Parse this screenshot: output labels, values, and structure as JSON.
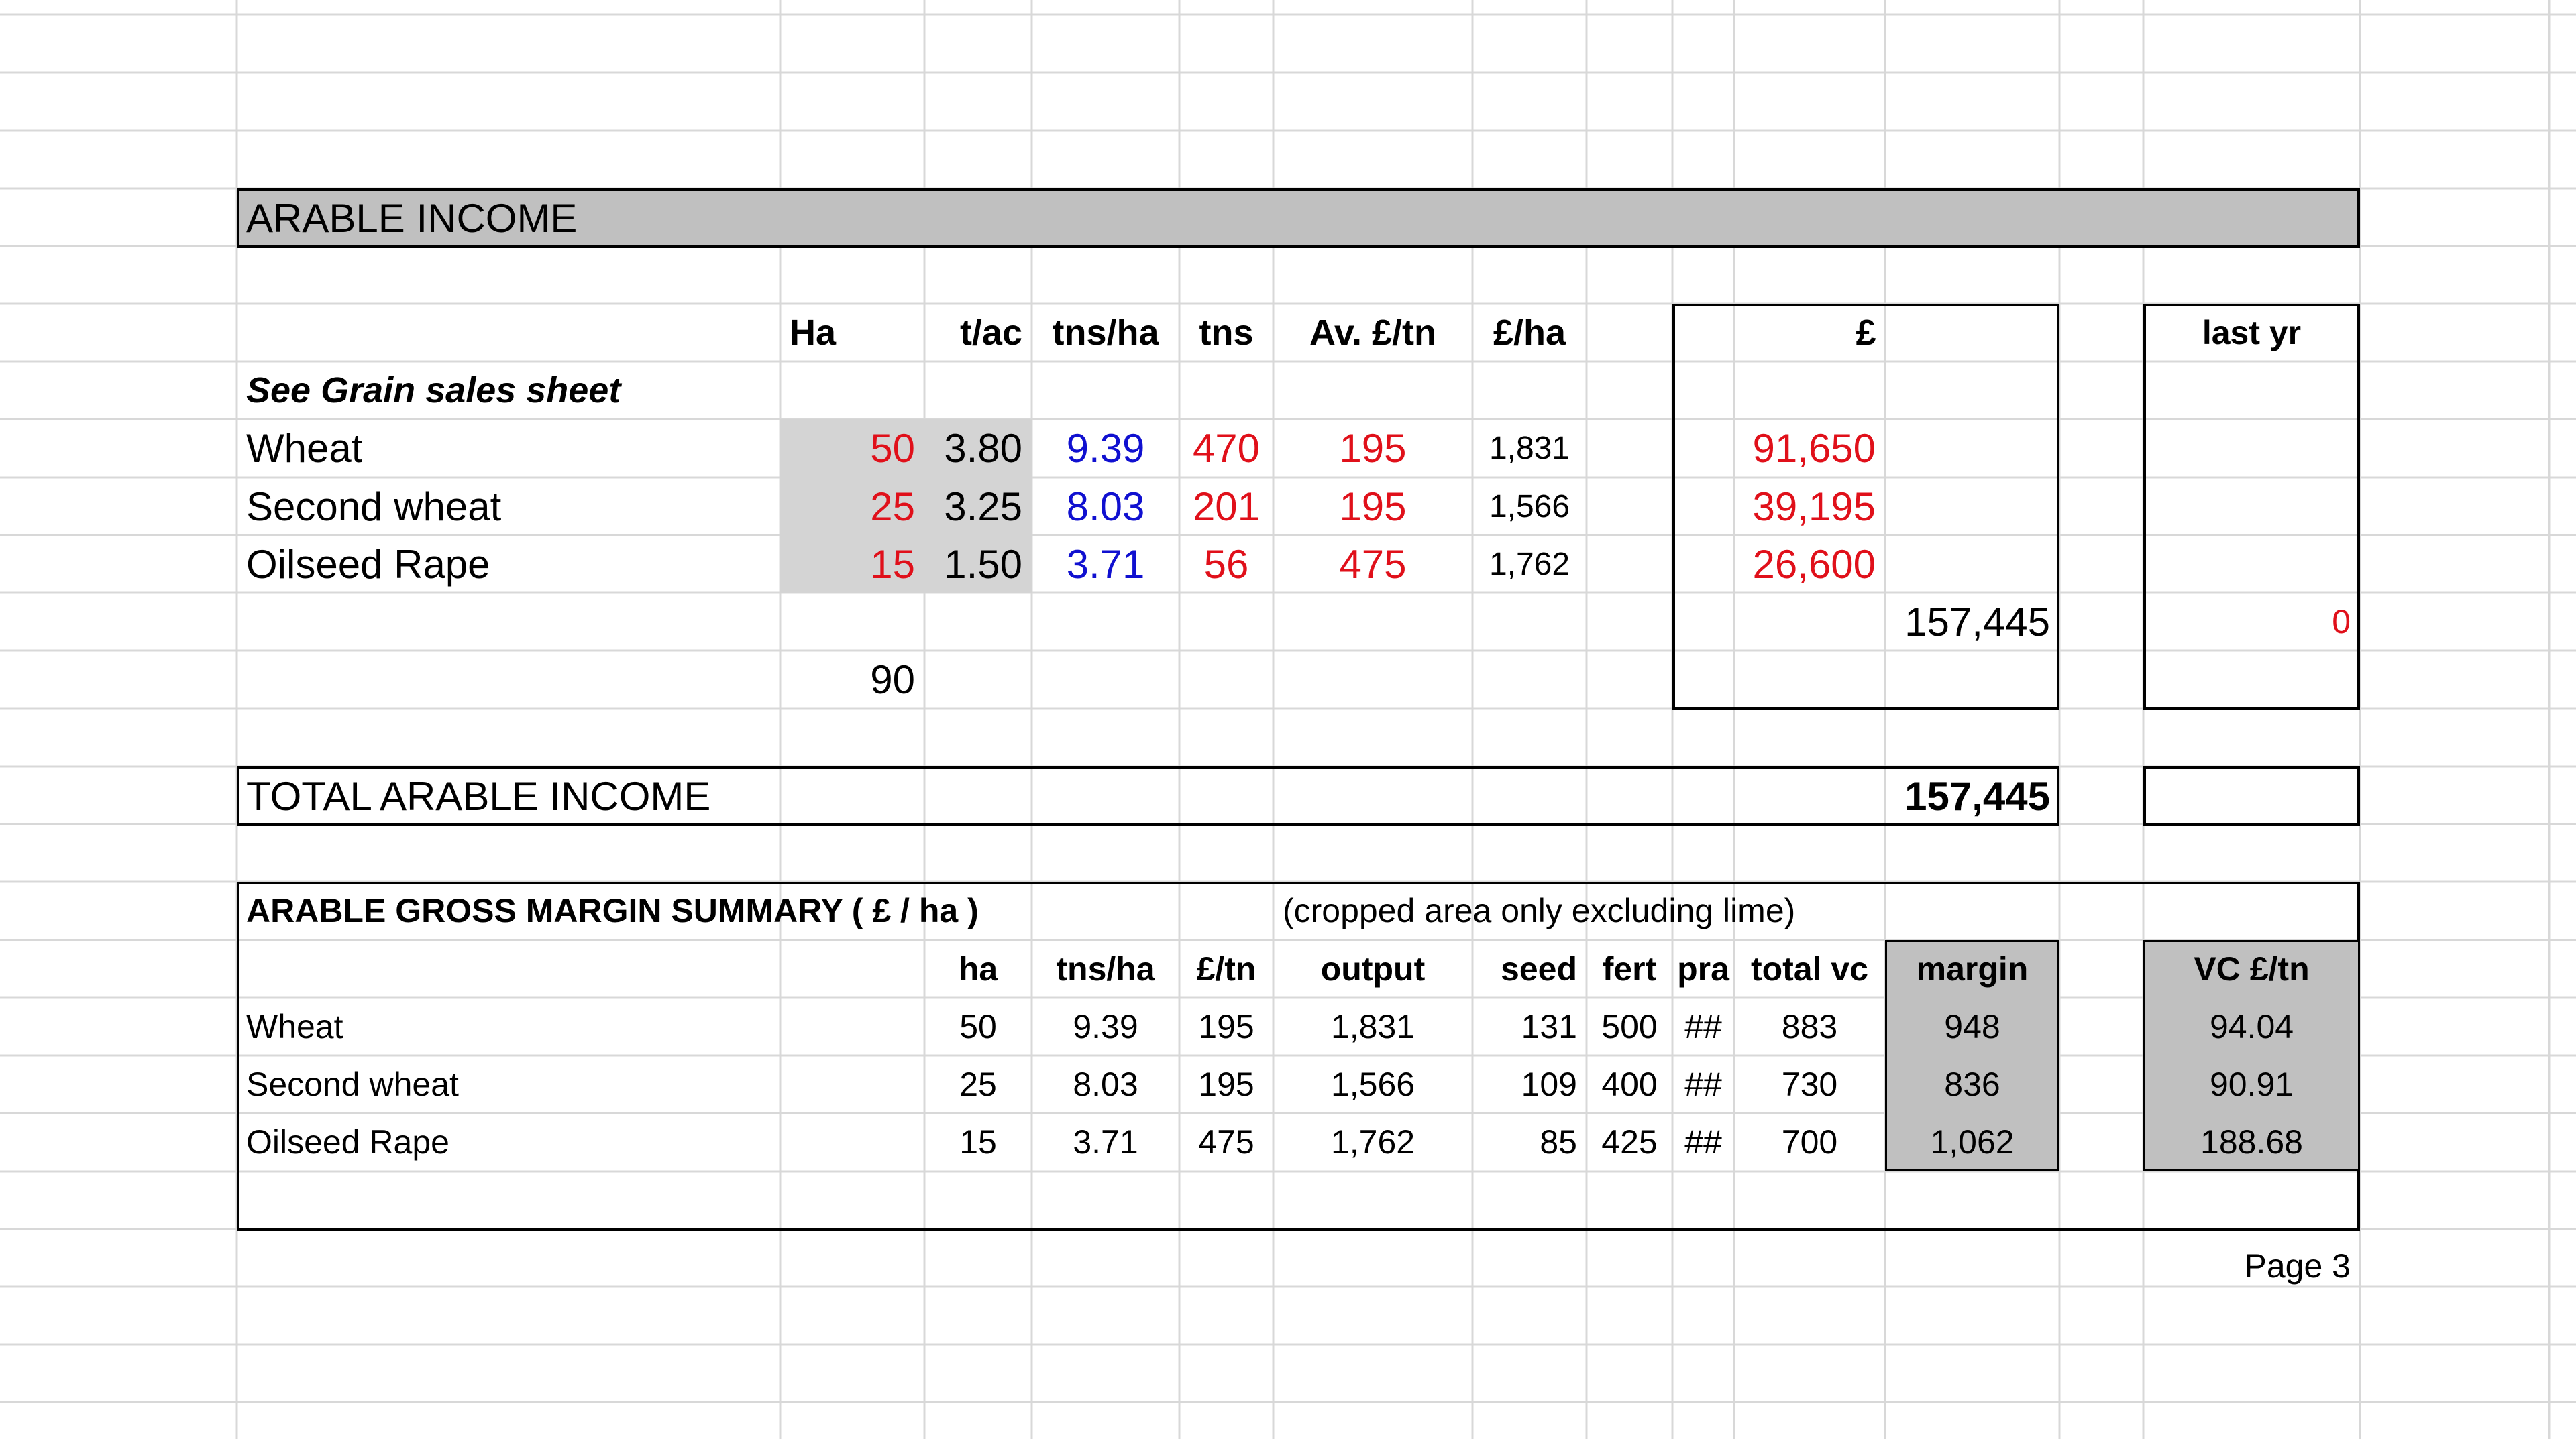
{
  "title_bar": "ARABLE INCOME",
  "income": {
    "headers": {
      "ha": "Ha",
      "tac": "t/ac",
      "tnsha": "tns/ha",
      "tns": "tns",
      "avtn": "Av. £/tn",
      "perha": "£/ha",
      "pound": "£",
      "last_yr": "last yr"
    },
    "note": "See Grain sales sheet",
    "rows": [
      {
        "crop": "Wheat",
        "ha": "50",
        "tac": "3.80",
        "tnsha": "9.39",
        "tns": "470",
        "avtn": "195",
        "perha": "1,831",
        "pound": "91,650"
      },
      {
        "crop": "Second wheat",
        "ha": "25",
        "tac": "3.25",
        "tnsha": "8.03",
        "tns": "201",
        "avtn": "195",
        "perha": "1,566",
        "pound": "39,195"
      },
      {
        "crop": "Oilseed Rape",
        "ha": "15",
        "tac": "1.50",
        "tnsha": "3.71",
        "tns": "56",
        "avtn": "475",
        "perha": "1,762",
        "pound": "26,600"
      }
    ],
    "subtotal": "157,445",
    "last_yr_value": "0",
    "total_ha": "90"
  },
  "total": {
    "label": "TOTAL ARABLE INCOME",
    "value": "157,445"
  },
  "summary": {
    "title": "ARABLE GROSS MARGIN SUMMARY ( £ / ha )",
    "note": "(cropped area only excluding lime)",
    "headers": {
      "ha": "ha",
      "tnsha": "tns/ha",
      "tn": "£/tn",
      "output": "output",
      "seed": "seed",
      "fert": "fert",
      "pra": "pra",
      "totalvc": "total vc",
      "margin": "margin",
      "vctn": "VC £/tn"
    },
    "rows": [
      {
        "crop": "Wheat",
        "ha": "50",
        "tnsha": "9.39",
        "tn": "195",
        "output": "1,831",
        "seed": "131",
        "fert": "500",
        "pra": "##",
        "totalvc": "883",
        "margin": "948",
        "vctn": "94.04"
      },
      {
        "crop": "Second wheat",
        "ha": "25",
        "tnsha": "8.03",
        "tn": "195",
        "output": "1,566",
        "seed": "109",
        "fert": "400",
        "pra": "##",
        "totalvc": "730",
        "margin": "836",
        "vctn": "90.91"
      },
      {
        "crop": "Oilseed Rape",
        "ha": "15",
        "tnsha": "3.71",
        "tn": "475",
        "output": "1,762",
        "seed": "85",
        "fert": "425",
        "pra": "##",
        "totalvc": "700",
        "margin": "1,062",
        "vctn": "188.68"
      }
    ]
  },
  "page_label": "Page 3",
  "colors": {
    "header_fill": "#c0c0c0",
    "input_fill": "#d4d4d4",
    "red": "#e0101a",
    "blue": "#1010d0",
    "gridline": "#d8d8d8"
  }
}
